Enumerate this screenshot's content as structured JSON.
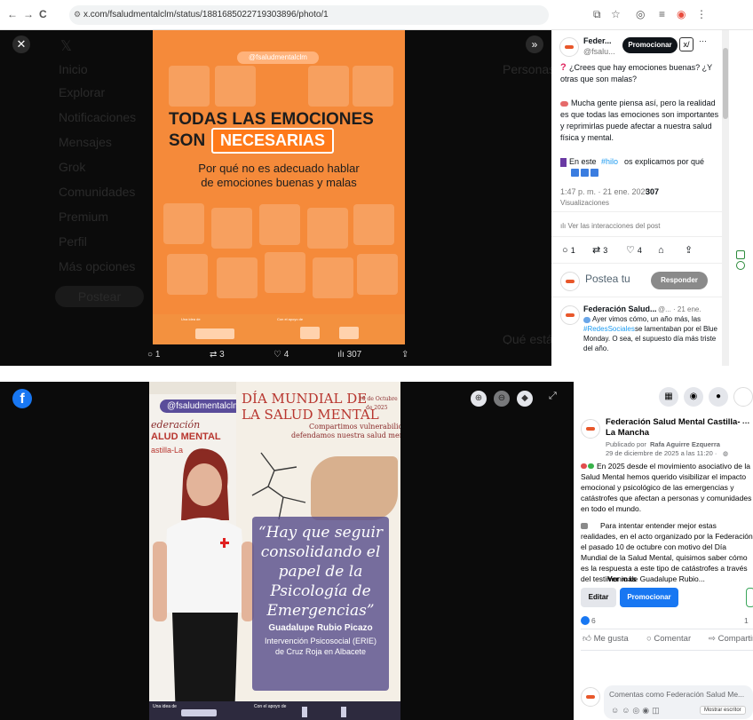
{
  "browser": {
    "url": "x.com/fsaludmentalclm/status/1881685022719303896/photo/1",
    "back_icon": "←",
    "forward_icon": "→",
    "reload_icon": "C"
  },
  "x_nav_ghost": [
    "Inicio",
    "Explorar",
    "Notificaciones",
    "Mensajes",
    "Grok",
    "Comunidades",
    "Premium",
    "Perfil",
    "Más opciones"
  ],
  "x_ghost_post": "Postear",
  "x_ghost_right": [
    "Personas",
    "Qué está pasando"
  ],
  "x_image": {
    "handle": "@fsaludmentalclm",
    "head1": "TODAS LAS EMOCIONES",
    "head2a": "SON",
    "head2b": "NECESARIAS",
    "sub1": "Por qué no es adecuado hablar",
    "sub2": "de emociones buenas y malas",
    "logo_left_label": "Una idea de",
    "logo_right_label": "Con el apoyo de"
  },
  "x_stats": {
    "replies": "1",
    "reposts": "3",
    "likes": "4",
    "views": "307"
  },
  "x_side": {
    "author_name": "Feder...",
    "author_handle": "@fsalu...",
    "promote": "Promocionar",
    "more": "···",
    "q_mark": "?",
    "text1": "¿Crees que hay emociones buenas? ¿Y otras que son malas?",
    "text2": "Mucha gente piensa así, pero la realidad es que todas las emociones son importantes y reprimirlas puede afectar a nuestra salud física y mental.",
    "text3_a": "En este",
    "text3_link": "#hilo",
    "text3_b": "os explicamos por qué",
    "timestamp": "1:47 p. m. · 21 ene. 2025 ·",
    "views": "307",
    "views_label": "Visualizaciones",
    "interactions": "Ver las interacciones del post",
    "replies": "1",
    "reposts": "3",
    "likes": "4",
    "reply_placeholder": "Postea tu",
    "reply_button": "Responder",
    "reply2_name": "Federación Salud...",
    "reply2_meta": "@... · 21 ene.",
    "reply2_text": "Ayer vimos cómo, un año más, las",
    "reply2_link": "#RedesSociales",
    "reply2_text2": "se lamentaban por el Blue Monday. O sea, el supuesto día más triste del año."
  },
  "fb_photo": {
    "handle": "@fsaludmentalclm",
    "fed_l1": "ederación",
    "fed_l2": "ALUD MENTAL",
    "fed_l3": "astilla-La",
    "dia_title1": "DÍA MUNDIAL DE",
    "dia_title2": "LA SALUD MENTAL",
    "dia_date": "10 de Octubre",
    "dia_year": "de 2025",
    "dia_sub1": "Compartimos vulnerabilidad,",
    "dia_sub2": "defendamos nuestra salud mental",
    "quote": [
      "“Hay que seguir",
      "consolidando el",
      "papel de la",
      "Psicología de",
      "Emergencias”"
    ],
    "person_name": "Guadalupe Rubio Picazo",
    "person_role1": "Intervención Psicosocial (ERIE)",
    "person_role2": "de Cruz Roja en Albacete",
    "footer_left": "Una idea de",
    "footer_right": "Con el apoyo de"
  },
  "fb_side": {
    "page_name": "Federación Salud Mental Castilla-La Mancha",
    "published_by": "Publicado por",
    "published_author": "Rafa Aguirre Ezquerra",
    "published_date": "29 de diciembre de 2025 a las 11:20 ·",
    "p1": "En 2025 desde el movimiento asociativo de la Salud Mental hemos querido visibilizar el impacto emocional y psicológico de las emergencias y catástrofes que afectan a personas y comunidades en todo el mundo.",
    "p2": "Para intentar entender mejor estas realidades, en el acto organizado por la Federación el pasado 10 de octubre con motivo del Día Mundial de la Salud Mental, quisimos saber cómo es la respuesta a este tipo de catástrofes a través del testimonio de Guadalupe Rubio...",
    "see_more": "Ver más",
    "edit": "Editar",
    "promote": "Promocionar",
    "reactions_count": "6",
    "shares_count": "1",
    "like": "Me gusta",
    "comment": "Comentar",
    "share": "Compartir",
    "comment_placeholder": "Comentas como Federación Salud Me...",
    "show_writer": "Mostrar escritor"
  },
  "colors": {
    "x_orange": "#f58a3a",
    "x_pill": "#ff7a1a",
    "fb_blue": "#1877f2",
    "quote_purple": "#5a508c"
  }
}
